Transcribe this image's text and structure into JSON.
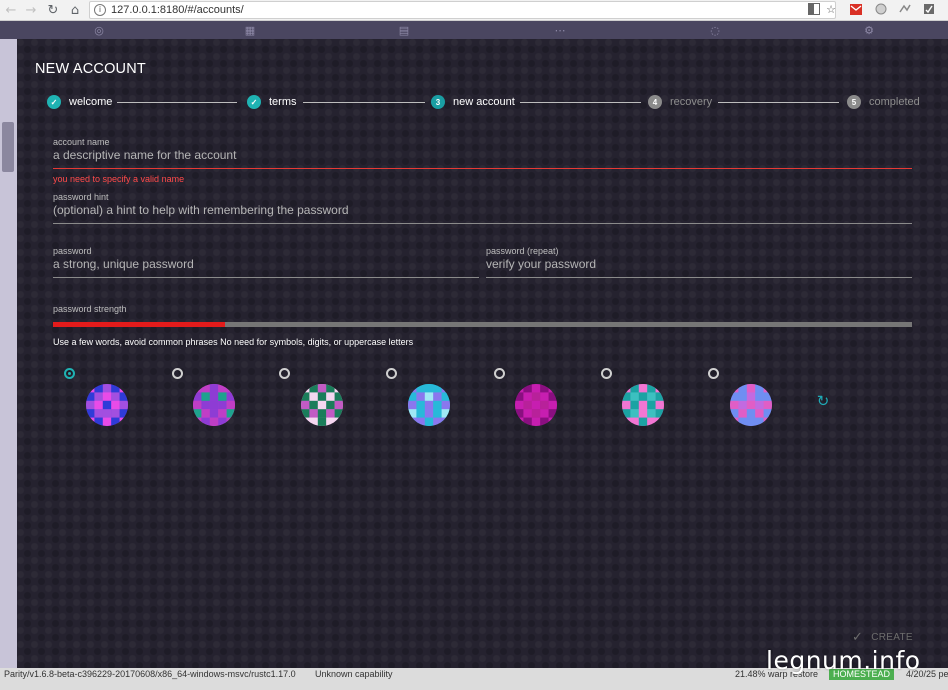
{
  "browser": {
    "url": "127.0.0.1:8180/#/accounts/",
    "nav": {
      "back": "←",
      "forward": "→",
      "reload": "↻",
      "home": "⌂"
    },
    "info_icon": "i",
    "right_icons": [
      "translate-icon",
      "star-icon",
      "mail-icon",
      "extension-icon",
      "extension-icon-2",
      "menu-icon"
    ]
  },
  "modal": {
    "title": "NEW ACCOUNT",
    "steps": [
      {
        "label": "welcome",
        "state": "done",
        "marker": "✓"
      },
      {
        "label": "terms",
        "state": "done",
        "marker": "✓"
      },
      {
        "label": "new account",
        "state": "active",
        "marker": "3"
      },
      {
        "label": "recovery",
        "state": "todo",
        "marker": "4"
      },
      {
        "label": "completed",
        "state": "todo",
        "marker": "5"
      }
    ],
    "fields": {
      "account_name": {
        "label": "account name",
        "placeholder": "a descriptive name for the account",
        "value": "",
        "error": "you need to specify a valid name"
      },
      "password_hint": {
        "label": "password hint",
        "placeholder": "(optional) a hint to help with remembering the password",
        "value": ""
      },
      "password": {
        "label": "password",
        "placeholder": "a strong, unique password",
        "value": ""
      },
      "password_repeat": {
        "label": "password (repeat)",
        "placeholder": "verify your password",
        "value": ""
      }
    },
    "strength": {
      "label": "password strength",
      "level": 0.2,
      "hint": "Use a few words, avoid common phrases No need for symbols, digits, or uppercase letters"
    },
    "identicons": {
      "selected_index": 0,
      "items": [
        {
          "bg": "#8b2be2",
          "colors": [
            "#e84be8",
            "#2f3bd8",
            "#a24fe0"
          ]
        },
        {
          "bg": "#e34fd9",
          "colors": [
            "#c03ec6",
            "#8e3cd4",
            "#1fa28e"
          ]
        },
        {
          "bg": "#f2b6e9",
          "colors": [
            "#1a7d5a",
            "#f5d7f0",
            "#c25bc4"
          ]
        },
        {
          "bg": "#1fd0e6",
          "colors": [
            "#8a77ee",
            "#28b9d9",
            "#a0e8f5"
          ]
        },
        {
          "bg": "#a0138e",
          "colors": [
            "#c71eb0",
            "#8a0f80",
            "#b8219a"
          ]
        },
        {
          "bg": "#e063c9",
          "colors": [
            "#1ba3a3",
            "#f276d3",
            "#3cc0c0"
          ]
        },
        {
          "bg": "#a07ee8",
          "colors": [
            "#e05ec6",
            "#6f8ef2",
            "#c26ae0"
          ]
        }
      ],
      "refresh_icon": "↻"
    },
    "create_label": "CREATE",
    "create_icon": "✓"
  },
  "status": {
    "version": "Parity/v1.6.8-beta-c396229-20170608/x86_64-windows-msvc/rustc1.17.0",
    "capability": "Unknown capability",
    "warp": "21.48% warp restore",
    "network": "HOMESTEAD",
    "date": "4/20/25 pe"
  },
  "watermark": "legnum.info"
}
